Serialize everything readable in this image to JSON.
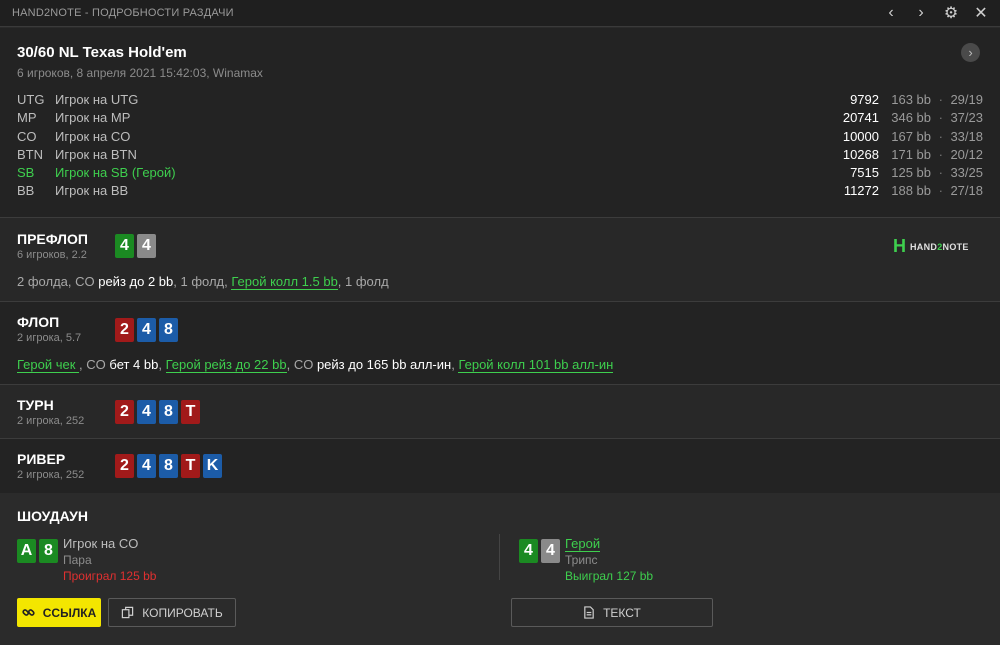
{
  "window": {
    "title": "HAND2NOTE - ПОДРОБНОСТИ РАЗДАЧИ",
    "prev_icon": "‹",
    "next_icon": "›",
    "settings_icon": "⚙",
    "close_icon": "✕"
  },
  "hand": {
    "title": "30/60 NL Texas Hold'em",
    "subtitle": "6 игроков, 8 апреля 2021 15:42:03, Winamax",
    "next_hand_icon": "›"
  },
  "players": [
    {
      "pos": "UTG",
      "name": "Игрок на UTG",
      "chips": "9792",
      "bb": "163 bb",
      "dot": "·",
      "stat": "29/19"
    },
    {
      "pos": "MP",
      "name": "Игрок на MP",
      "chips": "20741",
      "bb": "346 bb",
      "dot": "·",
      "stat": "37/23"
    },
    {
      "pos": "CO",
      "name": "Игрок на CO",
      "chips": "10000",
      "bb": "167 bb",
      "dot": "·",
      "stat": "33/18"
    },
    {
      "pos": "BTN",
      "name": "Игрок на BTN",
      "chips": "10268",
      "bb": "171 bb",
      "dot": "·",
      "stat": "20/12"
    },
    {
      "pos": "SB",
      "name": "Игрок на SB (Герой)",
      "chips": "7515",
      "bb": "125 bb",
      "dot": "·",
      "stat": "33/25"
    },
    {
      "pos": "BB",
      "name": "Игрок на BB",
      "chips": "11272",
      "bb": "188 bb",
      "dot": "·",
      "stat": "27/18"
    }
  ],
  "brand": {
    "icon": "H",
    "text_a": "HAND",
    "text_b": "2",
    "text_c": "NOTE"
  },
  "streets": {
    "preflop": {
      "name": "ПРЕФЛОП",
      "sub": "6 игроков, 2.2",
      "cards": [
        "4",
        "4"
      ],
      "actions": {
        "a1": "2 фолда, CO ",
        "a2": "рейз до 2 bb",
        "a3": ", 1 фолд, ",
        "a4": "Герой колл 1.5 bb",
        "a5": ", 1 фолд"
      }
    },
    "flop": {
      "name": "ФЛОП",
      "sub": "2 игрока, 5.7",
      "cards": [
        "2",
        "4",
        "8"
      ],
      "actions": {
        "a1": "Герой чек ",
        "a2": ", CO ",
        "a3": "бет 4 bb",
        "a4": ", ",
        "a5": "Герой рейз до 22 bb",
        "a6": ", CO ",
        "a7": "рейз до 165 bb алл-ин",
        "a8": ", ",
        "a9": "Герой колл 101 bb алл-ин"
      }
    },
    "turn": {
      "name": "ТУРН",
      "sub": "2 игрока, 252",
      "cards": [
        "2",
        "4",
        "8",
        "T"
      ]
    },
    "river": {
      "name": "РИВЕР",
      "sub": "2 игрока, 252",
      "cards": [
        "2",
        "4",
        "8",
        "T",
        "K"
      ]
    }
  },
  "showdown": {
    "title": "ШОУДАУН",
    "villain": {
      "cards": [
        "A",
        "8"
      ],
      "name": "Игрок на CO",
      "hand": "Пара",
      "result": "Проиграл 125 bb"
    },
    "hero": {
      "cards": [
        "4",
        "4"
      ],
      "name": "Герой",
      "hand": "Трипс",
      "result": "Выиграл 127 bb"
    }
  },
  "buttons": {
    "link": {
      "label": "ССЫЛКА",
      "icon": "link-icon"
    },
    "copy": {
      "label": "КОПИРОВАТЬ",
      "icon": "copy-icon"
    },
    "text": {
      "label": "ТЕКСТ",
      "icon": "document-icon"
    }
  },
  "colors": {
    "hero_green": "#3ecf4e",
    "card_green": "#1b8a22",
    "card_gray": "#8a8a8a",
    "card_red": "#a11a1a",
    "card_blue": "#1c5ca8",
    "lost_red": "#e03030",
    "link_yellow": "#f3e600"
  }
}
